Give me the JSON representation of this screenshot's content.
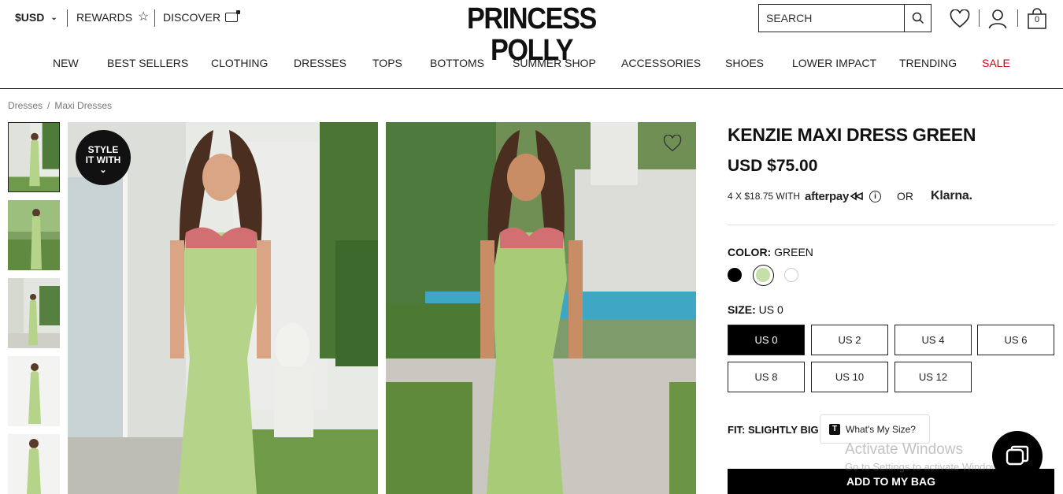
{
  "header": {
    "currency": "$USD",
    "rewards": "REWARDS",
    "discover": "DISCOVER",
    "logo": "PRINCESS POLLY",
    "search_placeholder": "SEARCH",
    "bag_count": "0"
  },
  "nav": [
    {
      "label": "NEW"
    },
    {
      "label": "BEST SELLERS"
    },
    {
      "label": "CLOTHING"
    },
    {
      "label": "DRESSES"
    },
    {
      "label": "TOPS"
    },
    {
      "label": "BOTTOMS"
    },
    {
      "label": "SUMMER SHOP"
    },
    {
      "label": "ACCESSORIES"
    },
    {
      "label": "SHOES"
    },
    {
      "label": "LOWER IMPACT"
    },
    {
      "label": "TRENDING"
    },
    {
      "label": "SALE"
    }
  ],
  "breadcrumb": {
    "items": [
      "Dresses",
      "Maxi Dresses"
    ],
    "separator": "/"
  },
  "gallery": {
    "style_badge_line1": "STYLE",
    "style_badge_line2": "IT WITH",
    "thumbnail_count": 5,
    "active_thumbnail": 1
  },
  "product": {
    "title": "KENZIE MAXI DRESS GREEN",
    "price": "USD $75.00",
    "installments": "4 X $18.75 WITH",
    "afterpay": "afterpay",
    "or": "OR",
    "klarna": "Klarna.",
    "color_label": "COLOR:",
    "color_value": "GREEN",
    "colors": [
      {
        "name": "black",
        "hex": "#000000"
      },
      {
        "name": "green",
        "hex": "#c6dfa8"
      },
      {
        "name": "white",
        "hex": "#ffffff"
      }
    ],
    "size_label": "SIZE:",
    "size_value": "US 0",
    "sizes": [
      "US 0",
      "US 2",
      "US 4",
      "US 6",
      "US 8",
      "US 10",
      "US 12"
    ],
    "selected_size": "US 0",
    "fit_label": "FIT:",
    "fit_value": "SLIGHTLY BIG",
    "whats_my_size": "What's My Size?",
    "add_to_bag": "ADD TO MY BAG"
  },
  "overlay": {
    "activate_title": "Activate Windows",
    "activate_sub": "Go to Settings to activate Windows."
  },
  "colors": {
    "sale": "#d0011b",
    "dress_green": "#b5d48a"
  }
}
